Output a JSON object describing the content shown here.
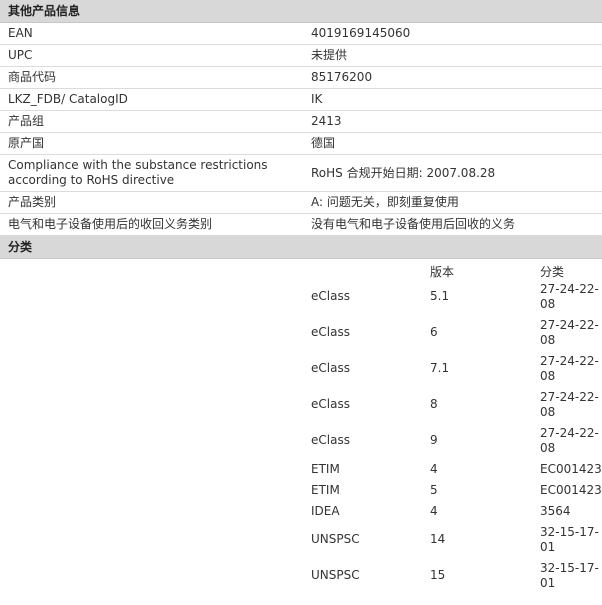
{
  "other_info": {
    "header": "其他产品信息",
    "rows": [
      {
        "label": "EAN",
        "value": "4019169145060"
      },
      {
        "label": "UPC",
        "value": "未提供"
      },
      {
        "label": "商品代码",
        "value": "85176200"
      },
      {
        "label": "LKZ_FDB/ CatalogID",
        "value": "IK"
      },
      {
        "label": "产品组",
        "value": "2413"
      },
      {
        "label": "原产国",
        "value": "德国"
      },
      {
        "label": "Compliance with the substance restrictions according to RoHS directive",
        "value": "RoHS 合规开始日期: 2007.08.28"
      },
      {
        "label": "产品类别",
        "value": "A: 问题无关，即刻重复使用"
      },
      {
        "label": "电气和电子设备使用后的收回义务类别",
        "value": "没有电气和电子设备使用后回收的义务"
      }
    ]
  },
  "classification": {
    "header": "分类",
    "col_version": "版本",
    "col_class": "分类",
    "rows": [
      {
        "system": "eClass",
        "version": "5.1",
        "code": "27-24-22-08"
      },
      {
        "system": "eClass",
        "version": "6",
        "code": "27-24-22-08"
      },
      {
        "system": "eClass",
        "version": "7.1",
        "code": "27-24-22-08"
      },
      {
        "system": "eClass",
        "version": "8",
        "code": "27-24-22-08"
      },
      {
        "system": "eClass",
        "version": "9",
        "code": "27-24-22-08"
      },
      {
        "system": "ETIM",
        "version": "4",
        "code": "EC001423"
      },
      {
        "system": "ETIM",
        "version": "5",
        "code": "EC001423"
      },
      {
        "system": "IDEA",
        "version": "4",
        "code": "3564"
      },
      {
        "system": "UNSPSC",
        "version": "14",
        "code": "32-15-17-01"
      },
      {
        "system": "UNSPSC",
        "version": "15",
        "code": "32-15-17-01"
      }
    ]
  }
}
